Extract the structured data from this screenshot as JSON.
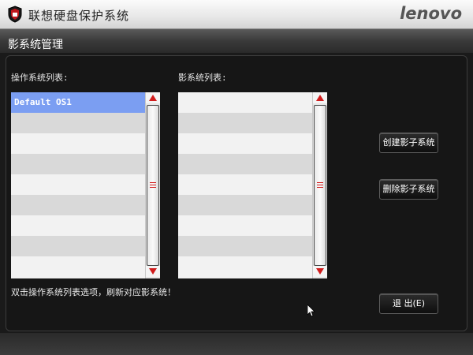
{
  "window": {
    "title": "联想硬盘保护系统",
    "brand": "lenovo"
  },
  "section": {
    "title": "影系统管理"
  },
  "os_list": {
    "label": "操作系统列表:",
    "items": [
      "Default OS1",
      "",
      "",
      "",
      "",
      "",
      "",
      "",
      ""
    ],
    "selected_index": 0
  },
  "shadow_list": {
    "label": "影系统列表:",
    "items": [
      "",
      "",
      "",
      "",
      "",
      "",
      "",
      "",
      ""
    ]
  },
  "buttons": {
    "create": "创建影子系统",
    "delete": "删除影子系统",
    "exit": "退 出(E)"
  },
  "hint": "双击操作系统列表选项，刷新对应影系统！",
  "colors": {
    "accent_selected": "#7b9ef2",
    "scroll_arrow": "#d11c1c"
  }
}
